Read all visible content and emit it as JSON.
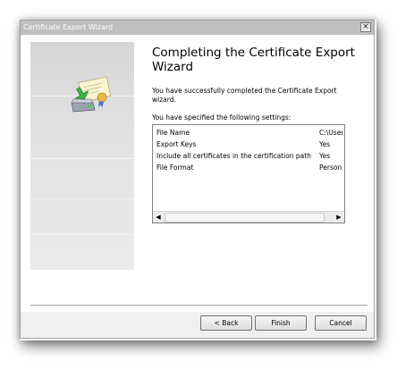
{
  "window": {
    "title": "Certificate Export Wizard",
    "close_glyph": "×"
  },
  "main": {
    "heading": "Completing the Certificate Export Wizard",
    "description": "You have successfully completed the Certificate Export wizard.",
    "settings_label": "You have specified the following settings:",
    "settings": [
      {
        "key": "File Name",
        "value": "C:\\User"
      },
      {
        "key": "Export Keys",
        "value": "Yes"
      },
      {
        "key": "Include all certificates in the certification path",
        "value": "Yes"
      },
      {
        "key": "File Format",
        "value": "Person"
      }
    ],
    "scroll_left_glyph": "◀",
    "scroll_right_glyph": "▶"
  },
  "buttons": {
    "back_label": "< Back",
    "finish_label": "Finish",
    "cancel_label": "Cancel"
  },
  "icons": {
    "close": "close-icon",
    "certificate": "certificate-export-icon",
    "scroll_left": "arrow-left-icon",
    "scroll_right": "arrow-right-icon"
  },
  "colors": {
    "titlebar": "#bfbfbf",
    "window_bg": "#f0f0f0",
    "content_bg": "#ffffff",
    "banner": "#d6d6d6"
  }
}
